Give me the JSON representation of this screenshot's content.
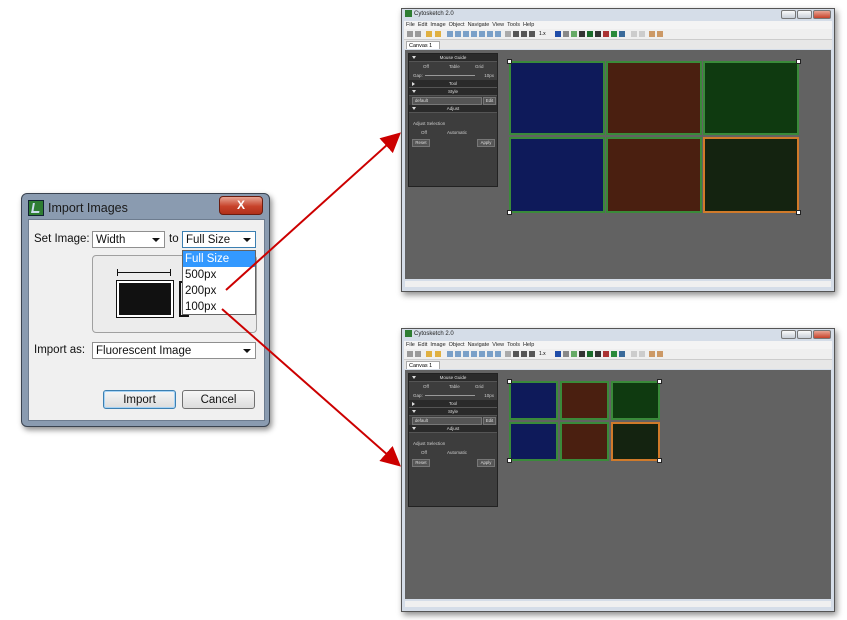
{
  "dialog": {
    "title": "Import Images",
    "close_label": "X",
    "set_image_label": "Set Image:",
    "dimension_select": "Width",
    "to_label": "to",
    "size_select": "Full Size",
    "size_options": [
      "Full Size",
      "500px",
      "200px",
      "100px"
    ],
    "selected_option": "Full Size",
    "import_as_label": "Import as:",
    "import_as_select": "Fluorescent Image",
    "import_button": "Import",
    "cancel_button": "Cancel"
  },
  "app_window": {
    "title": "Cytosketch 2.0",
    "menu": [
      "File",
      "Edit",
      "Image",
      "Object",
      "Navigate",
      "View",
      "Tools",
      "Help"
    ],
    "tab": "Canvas 1",
    "panel": {
      "mouse_guide": "Mouse Guide",
      "mg_options": [
        "Off",
        "Table",
        "Grid"
      ],
      "gap_label": "Gap:",
      "gap_value": "10px",
      "tool": "Tool",
      "style": "Style",
      "style_value": "default",
      "edit": "Edit",
      "adjust": "Adjust",
      "adjust_selection": "Adjust Selection",
      "adjust_options": [
        "Off",
        "Automatic"
      ],
      "reset": "Reset",
      "apply": "Apply"
    },
    "zoom": "1.x"
  },
  "colors": {
    "blue_tile": "#0e1a5a",
    "red_tile": "#4a1f10",
    "green_tile": "#0f3a10",
    "dark_green_tile": "#142310",
    "arrow": "#cc0000",
    "selection": "#3399ff"
  }
}
